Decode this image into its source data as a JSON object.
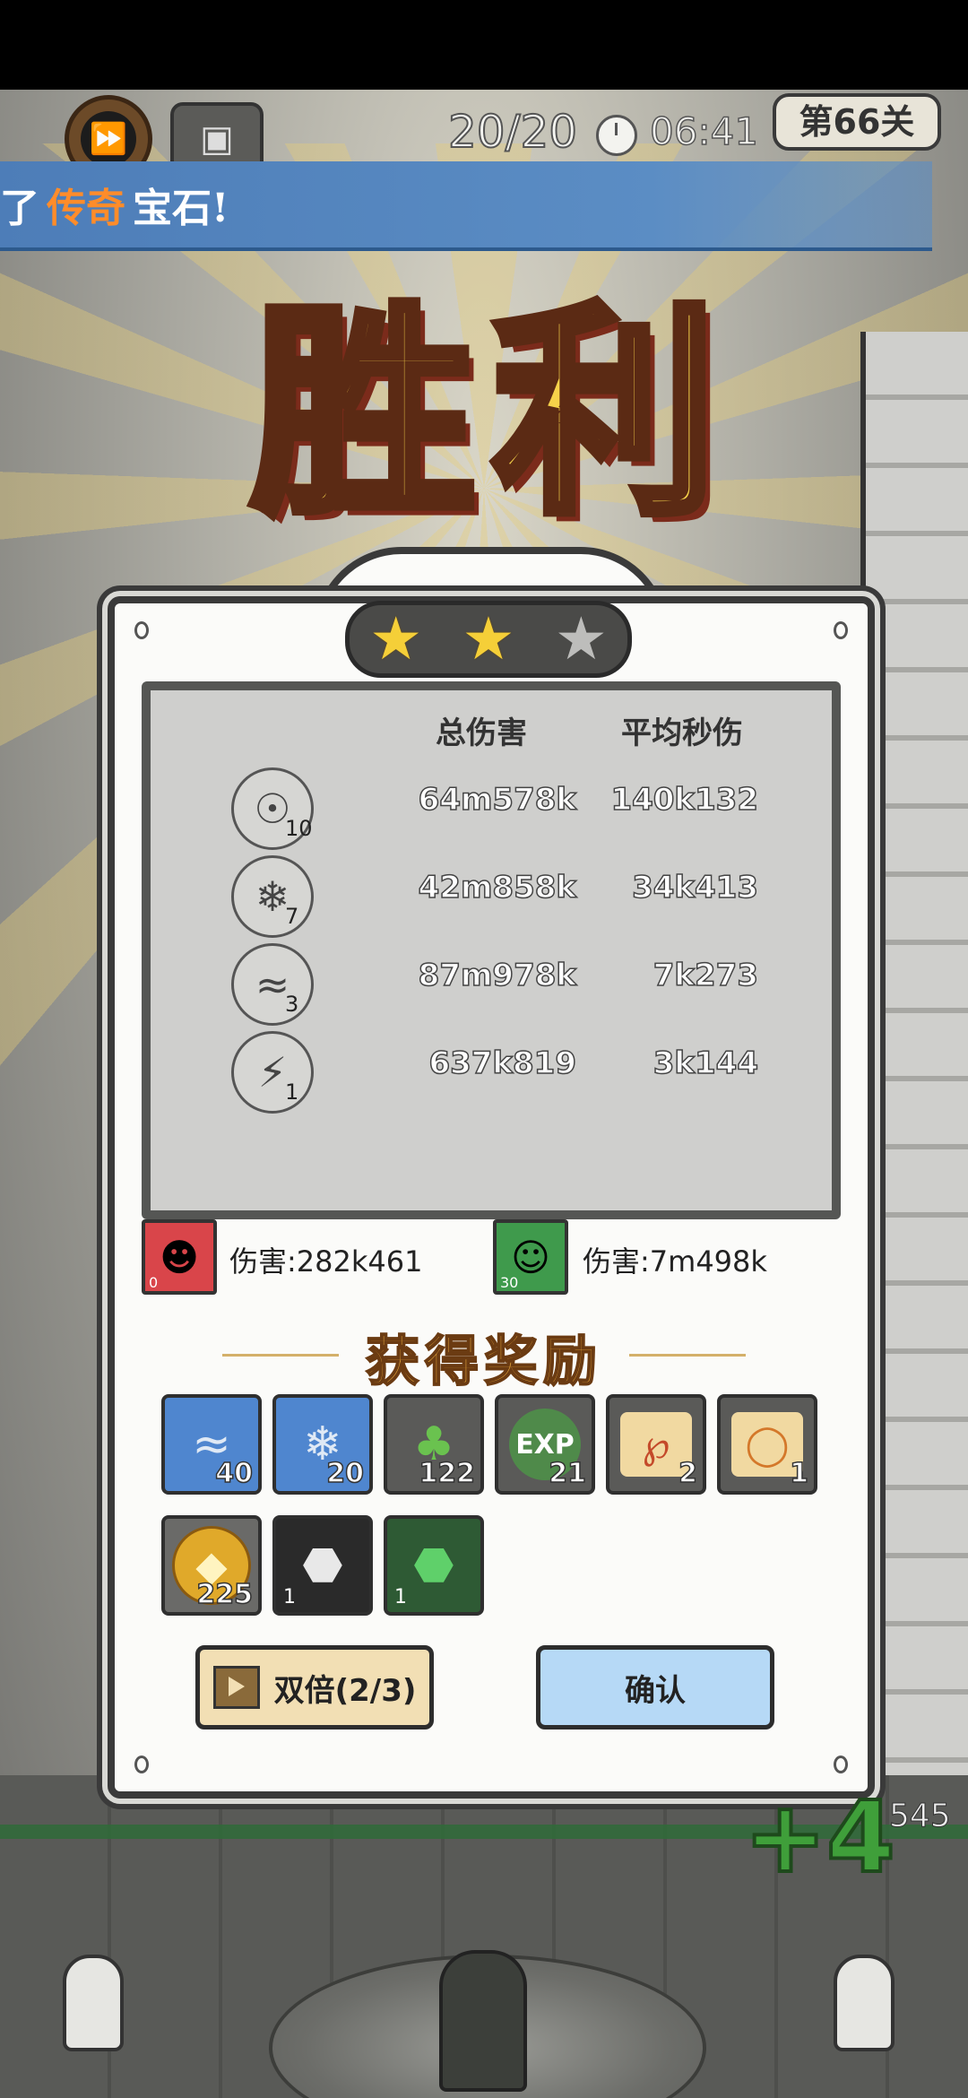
{
  "hud": {
    "wave": "20/20",
    "time": "06:41",
    "level": "第66关"
  },
  "banner": {
    "prefix": "了",
    "highlight": "传奇",
    "suffix": "宝石!",
    "highlight_color": "#ff8c2a"
  },
  "victory_title": "胜利",
  "stars": {
    "earned": 2,
    "total": 3
  },
  "stats": {
    "col_total": "总伤害",
    "col_dps": "平均秒伤",
    "rows": [
      {
        "icon": "tornado-icon",
        "level": "10",
        "total": "64m578k",
        "dps": "140k132"
      },
      {
        "icon": "ice-crystal-icon",
        "level": "7",
        "total": "42m858k",
        "dps": "34k413"
      },
      {
        "icon": "whirlwind-icon",
        "level": "3",
        "total": "87m978k",
        "dps": "7k273"
      },
      {
        "icon": "lightning-icon",
        "level": "1",
        "total": "637k819",
        "dps": "3k144"
      }
    ]
  },
  "heroes": [
    {
      "icon": "hero-portrait-dark-hair",
      "level": "0",
      "label": "伤害:282k461",
      "color": "#d9454a"
    },
    {
      "icon": "hero-portrait-brown-hair",
      "level": "30",
      "label": "伤害:7m498k",
      "color": "#3f9a4c"
    }
  ],
  "rewards_title": "获得奖励",
  "rewards": [
    {
      "icon": "whirlwind-card-icon",
      "count": "40",
      "bg": "#4f86cf"
    },
    {
      "icon": "ice-crystal-card-icon",
      "count": "20",
      "bg": "#4f86cf"
    },
    {
      "icon": "green-leaf-token-icon",
      "count": "122",
      "bg": "#5a5a58"
    },
    {
      "icon": "exp-token-icon",
      "count": "21",
      "bg": "#5a5a58"
    },
    {
      "icon": "scroll-red-rune-icon",
      "count": "2",
      "bg": "#5a5a58"
    },
    {
      "icon": "scroll-orange-rune-icon",
      "count": "1",
      "bg": "#5a5a58"
    },
    {
      "icon": "gold-coin-icon",
      "count": "225",
      "bg": "#6a6a68"
    },
    {
      "icon": "silver-gem-icon",
      "count": "1",
      "bg": "#2a2a2a"
    },
    {
      "icon": "green-gem-icon",
      "count": "1",
      "bg": "#2e5a34"
    }
  ],
  "buttons": {
    "double": "双倍(2/3)",
    "confirm": "确认"
  },
  "field": {
    "plus": "+4",
    "score": "545"
  }
}
